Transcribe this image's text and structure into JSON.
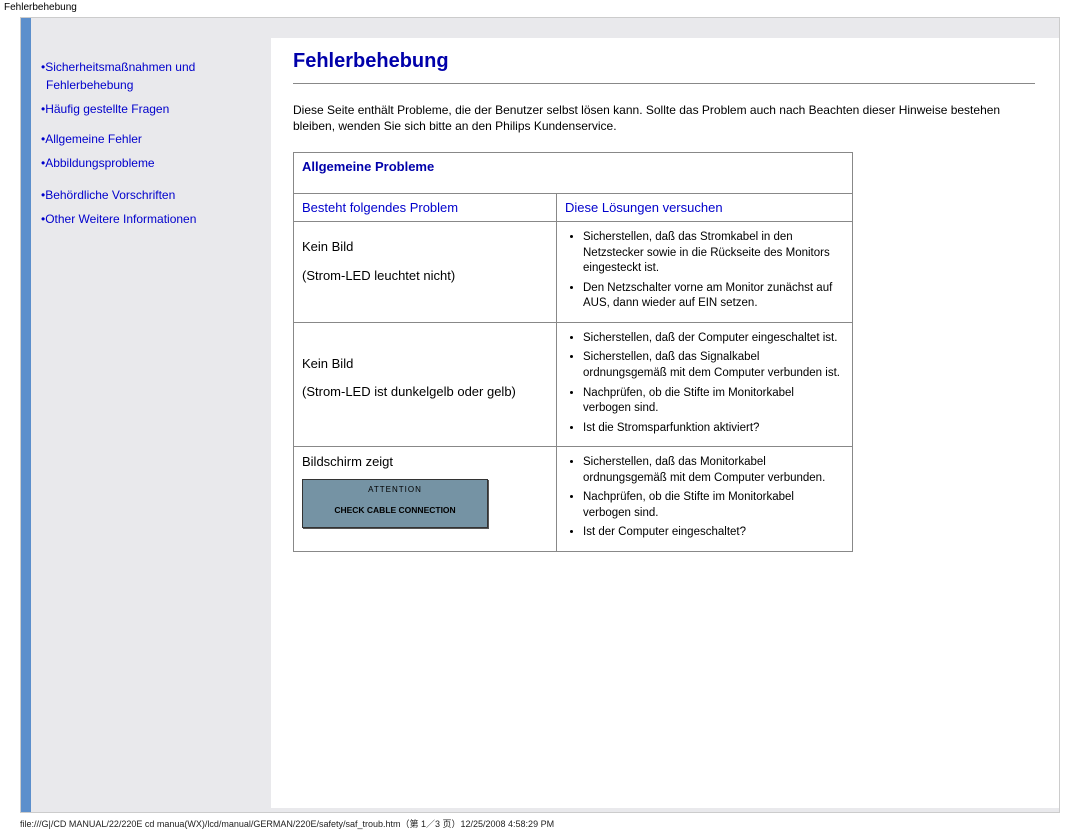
{
  "header": {
    "doc_title": "Fehlerbehebung"
  },
  "sidebar": {
    "items": [
      "Sicherheitsmaßnahmen und Fehlerbehebung",
      "Häufig gestellte Fragen",
      "Allgemeine Fehler",
      "Abbildungsprobleme",
      "Behördliche Vorschriften",
      "Other Weitere Informationen"
    ]
  },
  "main": {
    "title": "Fehlerbehebung",
    "intro": "Diese Seite enthält Probleme, die der Benutzer selbst lösen kann. Sollte das Problem auch nach Beachten dieser Hinweise bestehen bleiben, wenden Sie sich bitte an den Philips Kundenservice.",
    "table": {
      "section_header": "Allgemeine Probleme",
      "col1_header": "Besteht folgendes Problem",
      "col2_header": "Diese Lösungen versuchen",
      "rows": [
        {
          "problem_a": "Kein Bild",
          "problem_b": "(Strom-LED leuchtet nicht)",
          "solutions": [
            "Sicherstellen, daß das Stromkabel in den Netzstecker sowie in die Rückseite des Monitors eingesteckt ist.",
            "Den Netzschalter vorne am Monitor zunächst auf AUS, dann wieder auf EIN setzen."
          ]
        },
        {
          "problem_a": "Kein Bild",
          "problem_b": "(Strom-LED ist dunkelgelb oder gelb)",
          "solutions": [
            "Sicherstellen, daß der Computer eingeschaltet ist.",
            "Sicherstellen, daß das Signalkabel ordnungsgemäß mit dem Computer verbunden ist.",
            "Nachprüfen, ob die Stifte im Monitorkabel verbogen sind.",
            "Ist die Stromsparfunktion aktiviert?"
          ]
        },
        {
          "problem_a": "Bildschirm zeigt",
          "attention": {
            "label": "ATTENTION",
            "msg": "CHECK CABLE CONNECTION"
          },
          "solutions": [
            "Sicherstellen, daß das Monitorkabel ordnungsgemäß mit dem Computer verbunden.",
            "Nachprüfen, ob die Stifte im Monitorkabel verbogen sind.",
            "Ist der Computer eingeschaltet?"
          ]
        }
      ]
    }
  },
  "footer": "file:///G|/CD MANUAL/22/220E cd manua(WX)/lcd/manual/GERMAN/220E/safety/saf_troub.htm（第 1／3 页）12/25/2008 4:58:29 PM"
}
